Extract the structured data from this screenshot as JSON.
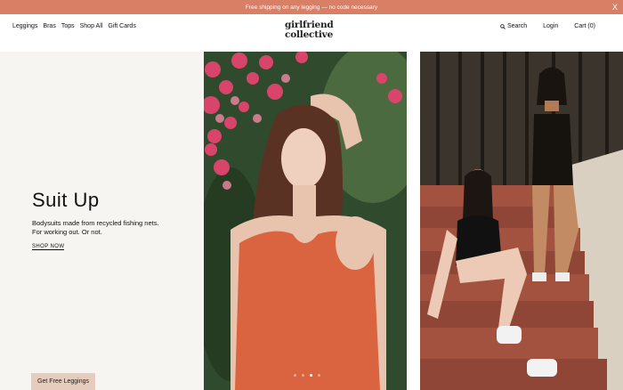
{
  "promo": {
    "text": "Free shipping on any legging — no code necessary",
    "close_label": "X"
  },
  "header": {
    "logo_line1": "girlfriend",
    "logo_line2": "collective",
    "nav_left": [
      "Leggings",
      "Bras",
      "Tops",
      "Shop All",
      "Gift Cards"
    ],
    "search_label": "Search",
    "login_label": "Login",
    "cart_label": "Cart (0)"
  },
  "hero": {
    "title": "Suit Up",
    "subtitle_line1": "Bodysuits made from recycled fishing nets.",
    "subtitle_line2": "For working out. Or not.",
    "shop_now_label": "SHOP NOW",
    "cta_label": "Get Free Leggings",
    "carousel": {
      "count": 4,
      "active_index": 2
    }
  },
  "colors": {
    "promo_bg": "#d97f66",
    "hero_panel_bg": "#f7f5f2",
    "cta_bg": "#e6ccbd"
  },
  "icons": [
    "search-icon",
    "close-icon"
  ]
}
